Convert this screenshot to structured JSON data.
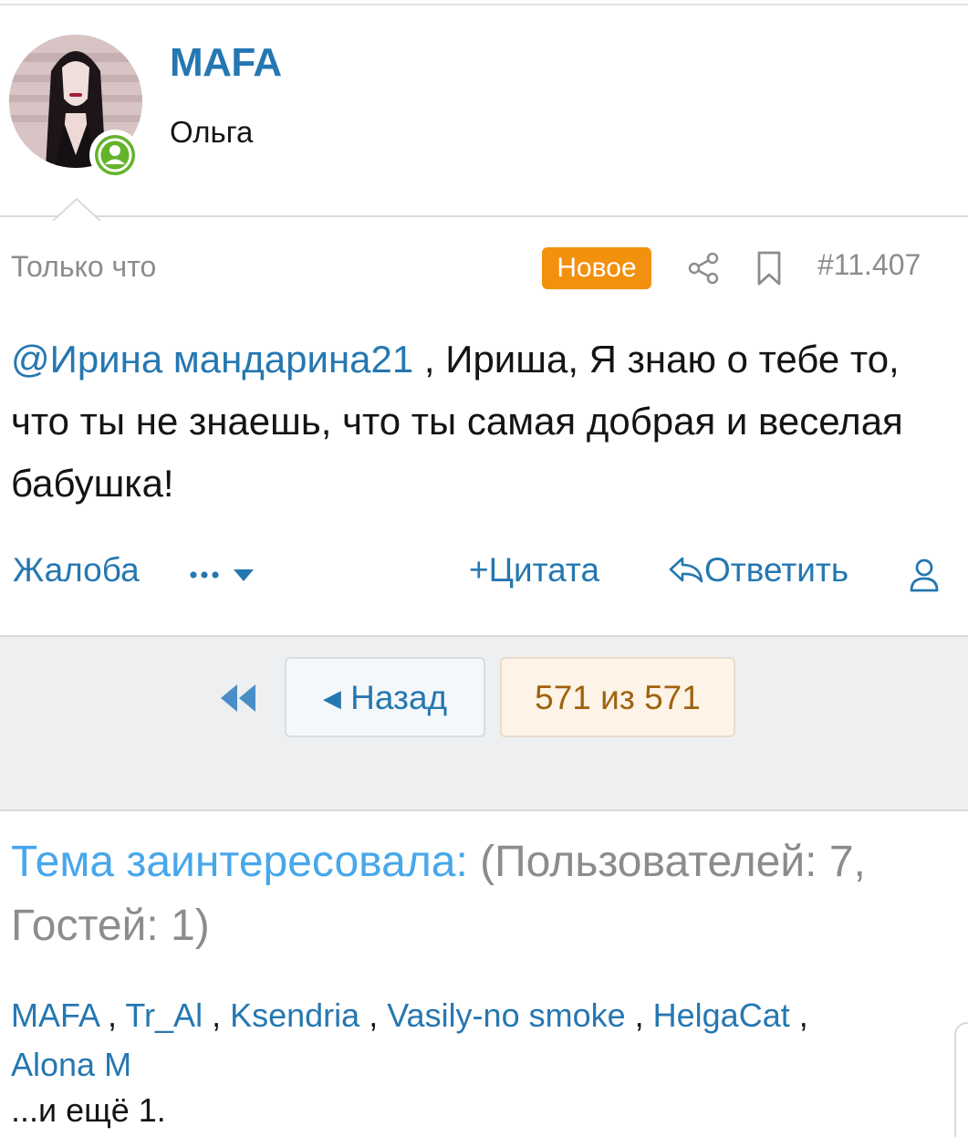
{
  "post": {
    "author": {
      "name": "MAFA",
      "title": "Ольга",
      "status_icon": "online-user-icon"
    },
    "time": "Только что",
    "badge": "Новое",
    "number": "#11.407",
    "mention": "@Ирина мандарина21",
    "text": " , Ириша, Я знаю о тебе то, что ты не знаешь, что ты самая добрая и веселая бабушка!",
    "actions": {
      "report": "Жалоба",
      "more": "•••",
      "quote": "Цитата",
      "reply": "Ответить"
    }
  },
  "pagination": {
    "back": "Назад",
    "pages": "571 из 571"
  },
  "viewers": {
    "label": "Тема заинтересовала:",
    "counts": " (Пользователей: 7, Гостей: 1)",
    "users": [
      "MAFA",
      "Tr_Al",
      "Ksendria",
      "Vasily-no smoke",
      "HelgaCat",
      "Alona M"
    ],
    "separator": " , ",
    "more": "...и ещё 1."
  },
  "colors": {
    "link": "#2577b1",
    "accent_orange": "#f3910e",
    "online_green": "#63b32b",
    "viewers_label": "#47a7eb"
  }
}
